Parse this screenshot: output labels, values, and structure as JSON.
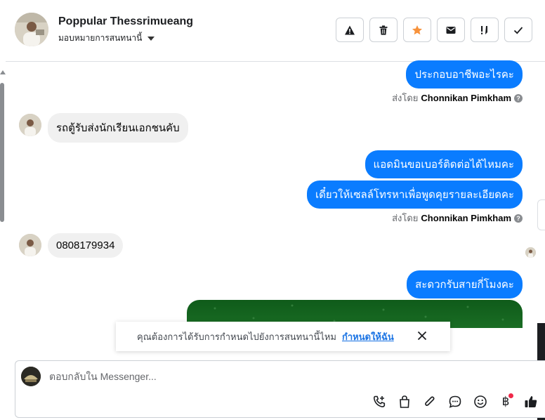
{
  "header": {
    "contact_name": "Poppular Thessrimueang",
    "assign_label": "มอบหมายการสนทนานี้",
    "actions": [
      {
        "icon": "alert-icon",
        "color": "#1c1e21"
      },
      {
        "icon": "trash-icon",
        "color": "#1c1e21"
      },
      {
        "icon": "star-icon",
        "color": "#f7923b"
      },
      {
        "icon": "mail-icon",
        "color": "#1c1e21"
      },
      {
        "icon": "important-icon",
        "color": "#1c1e21"
      },
      {
        "icon": "check-icon",
        "color": "#1c1e21"
      }
    ]
  },
  "thread": {
    "out_1": "ประกอบอาชีพอะไรคะ",
    "sent_by_label": "ส่งโดย",
    "sender_1": "Chonnikan Pimkham",
    "in_1": "รถตู้รับส่งนักเรียนเอกชนคับ",
    "out_2": "แอดมินขอเบอร์ติดต่อได้ไหมคะ",
    "out_3": "เดี๋ยวให้เซลล์โทรหาเพื่อพูดคุยรายละเอียดคะ",
    "sender_2": "Chonnikan Pimkham",
    "in_2": "0808179934",
    "out_4": "สะดวกรับสายกี่โมงคะ"
  },
  "notice": {
    "text": "คุณต้องการได้รับการกำหนดไปยังการสนทนานี้ไหม",
    "link": "กำหนดให้ฉัน"
  },
  "composer": {
    "placeholder": "ตอบกลับใน Messenger...",
    "currency_symbol": "฿"
  },
  "colors": {
    "accent": "#0a7cff",
    "incoming_bubble": "#f0f0f0",
    "link": "#1b74e4",
    "notification_dot": "#f02849"
  }
}
